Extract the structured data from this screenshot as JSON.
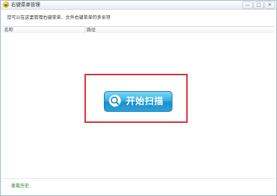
{
  "window": {
    "title": "右键菜单管理",
    "controls": {
      "minimize": "—",
      "maximize": "□",
      "close": "✕"
    }
  },
  "subtitle": "您可以在这里管理右键菜单、文件右键菜单的多余项",
  "list": {
    "columns": [
      "名称",
      "路径"
    ]
  },
  "scan_button": {
    "label": "开始扫描",
    "icon": "search-icon"
  },
  "footer": {
    "history_link": "查看历史"
  },
  "colors": {
    "highlight": "#d62929",
    "button": "#2aa3da",
    "link": "#2d7d2d"
  }
}
